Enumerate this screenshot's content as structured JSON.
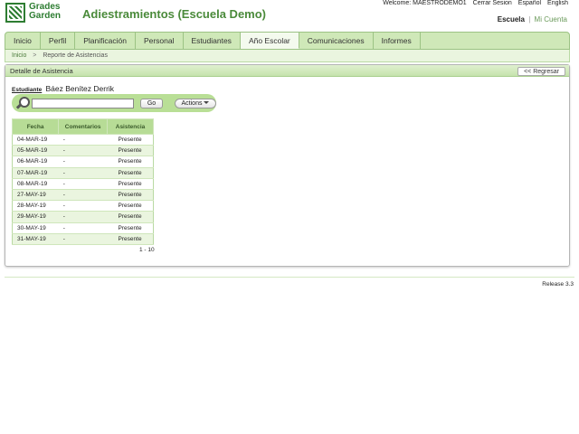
{
  "logo": {
    "line1": "Grades",
    "line2": "Garden"
  },
  "app_title": "Adiestramientos (Escuela Demo)",
  "topbar": {
    "welcome": "Welcome: MAESTRODEMO1",
    "logout": "Cerrar Sesion",
    "lang_es": "Español",
    "lang_en": "English"
  },
  "school_links": {
    "current": "Escuela",
    "separator": "|",
    "account": "Mi Cuenta"
  },
  "nav": {
    "tabs": [
      "Inicio",
      "Perfil",
      "Planificación",
      "Personal",
      "Estudiantes",
      "Año Escolar",
      "Comunicaciones",
      "Informes"
    ],
    "active": "Año Escolar"
  },
  "breadcrumb": {
    "home": "Inicio",
    "arrow": ">",
    "current": "Reporte de Asistencias"
  },
  "panel": {
    "title": "Detalle de Asistencia",
    "back": "<< Regresar"
  },
  "student": {
    "label": "Estudiante",
    "name": "Báez Benítez Derrik"
  },
  "search": {
    "value": "",
    "go": "Go",
    "actions": "Actions"
  },
  "table": {
    "headers": [
      "Fecha",
      "Comentarios",
      "Asistencia"
    ],
    "rows": [
      [
        "04-MAR-19",
        "-",
        "Presente"
      ],
      [
        "05-MAR-19",
        "-",
        "Presente"
      ],
      [
        "06-MAR-19",
        "-",
        "Presente"
      ],
      [
        "07-MAR-19",
        "-",
        "Presente"
      ],
      [
        "08-MAR-19",
        "-",
        "Presente"
      ],
      [
        "27-MAY-19",
        "-",
        "Presente"
      ],
      [
        "28-MAY-19",
        "-",
        "Presente"
      ],
      [
        "29-MAY-19",
        "-",
        "Presente"
      ],
      [
        "30-MAY-19",
        "-",
        "Presente"
      ],
      [
        "31-MAY-19",
        "-",
        "Presente"
      ]
    ],
    "pagination": "1 - 10"
  },
  "footer": {
    "release": "Release 3.3"
  },
  "colors": {
    "brand_green": "#4a8a3a",
    "nav_bg": "#cfe8b8",
    "table_header": "#b7dc96"
  },
  "icons": {
    "search": "magnifier-icon",
    "actions_caret": "caret-down-icon"
  }
}
